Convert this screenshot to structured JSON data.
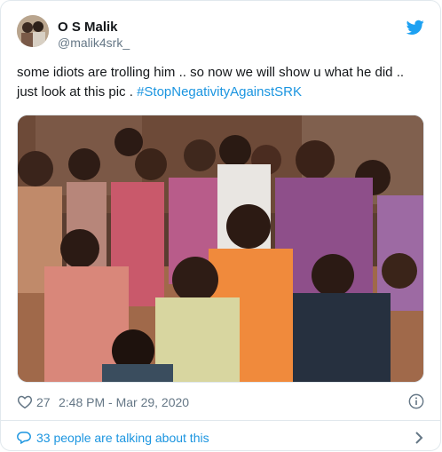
{
  "tweet": {
    "author_name": "O S Malik",
    "author_handle": "@malik4srk_",
    "text_main": "some idiots are trolling him .. so now we will show u what he did .. just look at this pic . ",
    "hashtag": "#StopNegativityAgainstSRK",
    "likes": "27",
    "timestamp": "2:48 PM - Mar 29, 2020",
    "talking": "33 people are talking about this"
  },
  "colors": {
    "link": "#1b95e0",
    "secondary_text": "#657786",
    "border": "#e1e8ed"
  },
  "icons": [
    "twitter-bird-icon",
    "heart-icon",
    "info-icon",
    "speech-bubble-icon",
    "chevron-right-icon"
  ]
}
